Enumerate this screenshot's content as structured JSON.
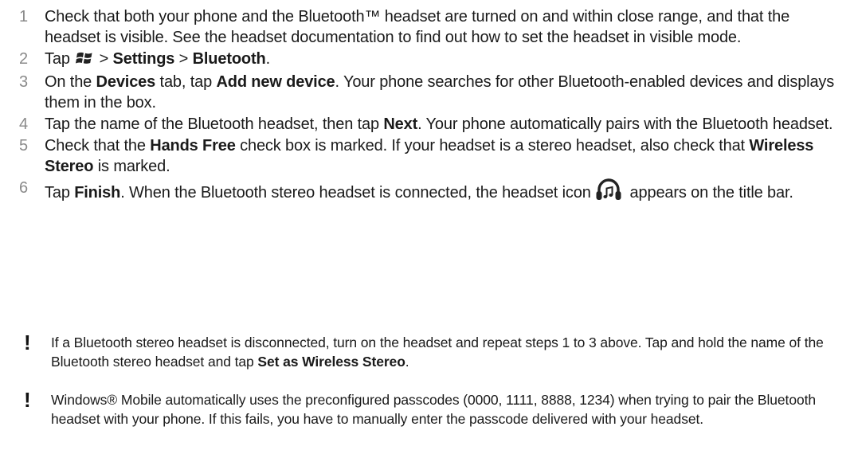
{
  "steps": [
    {
      "num": "1",
      "parts": [
        {
          "t": "Check that both your phone and the Bluetooth™ headset are turned on and within close range, and that the headset is visible. See the headset documentation to find out how to set the headset in visible mode."
        }
      ]
    },
    {
      "num": "2",
      "parts": [
        {
          "t": "Tap "
        },
        {
          "icon": "windows-start-icon"
        },
        {
          "t": " > "
        },
        {
          "t": "Settings",
          "b": true
        },
        {
          "t": " > "
        },
        {
          "t": "Bluetooth",
          "b": true
        },
        {
          "t": "."
        }
      ]
    },
    {
      "num": "3",
      "parts": [
        {
          "t": "On the "
        },
        {
          "t": "Devices",
          "b": true
        },
        {
          "t": " tab, tap "
        },
        {
          "t": "Add new device",
          "b": true
        },
        {
          "t": ". Your phone searches for other Bluetooth-enabled devices and displays them in the box."
        }
      ]
    },
    {
      "num": "4",
      "parts": [
        {
          "t": "Tap the name of the Bluetooth headset, then tap "
        },
        {
          "t": "Next",
          "b": true
        },
        {
          "t": ". Your phone automatically pairs with the Bluetooth headset."
        }
      ]
    },
    {
      "num": "5",
      "parts": [
        {
          "t": "Check that the "
        },
        {
          "t": "Hands Free",
          "b": true
        },
        {
          "t": " check box is marked. If your headset is a stereo headset, also check that "
        },
        {
          "t": "Wireless Stereo",
          "b": true
        },
        {
          "t": " is marked."
        }
      ]
    },
    {
      "num": "6",
      "parts": [
        {
          "t": "Tap "
        },
        {
          "t": "Finish",
          "b": true
        },
        {
          "t": ". When the Bluetooth stereo headset is connected, the headset icon "
        },
        {
          "icon": "headset-icon"
        },
        {
          "t": " appears on the title bar."
        }
      ]
    }
  ],
  "notes": [
    {
      "mark": "!",
      "parts": [
        {
          "t": "If a Bluetooth stereo headset is disconnected, turn on the headset and repeat steps 1 to 3 above. Tap and hold the name of the Bluetooth stereo headset and tap "
        },
        {
          "t": "Set as Wireless Stereo",
          "b": true
        },
        {
          "t": "."
        }
      ]
    },
    {
      "mark": "!",
      "parts": [
        {
          "t": "Windows® Mobile automatically uses the preconfigured passcodes (0000, 1111, 8888, 1234) when trying to pair the Bluetooth headset with your phone. If this fails, you have to manually enter the passcode delivered with your headset."
        }
      ]
    }
  ]
}
